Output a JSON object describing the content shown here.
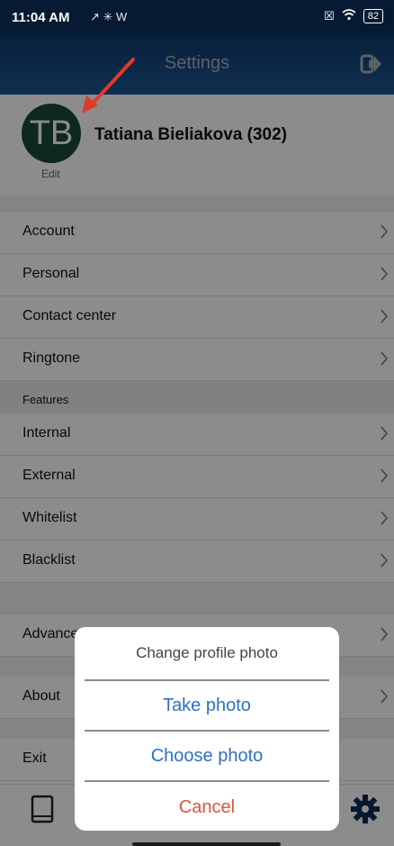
{
  "status_bar": {
    "time": "11:04 AM",
    "left_icons": "↗ ✳ W",
    "battery": "82"
  },
  "header": {
    "title": "Settings"
  },
  "profile": {
    "initials": "TB",
    "name": "Tatiana Bieliakova (302)",
    "edit_label": "Edit"
  },
  "menu": {
    "group1": [
      "Account",
      "Personal",
      "Contact center",
      "Ringtone"
    ],
    "features_header": "Features",
    "group2": [
      "Internal",
      "External",
      "Whitelist",
      "Blacklist"
    ],
    "advanced": "Advanced",
    "about": "About",
    "exit": "Exit"
  },
  "action_sheet": {
    "title": "Change profile photo",
    "take_photo": "Take photo",
    "choose_photo": "Choose photo",
    "cancel": "Cancel"
  },
  "colors": {
    "header": "#1e5694",
    "avatar": "#1b4a38",
    "action": "#2f6fc3",
    "cancel": "#e2533c",
    "arrow": "#e03a2a"
  }
}
